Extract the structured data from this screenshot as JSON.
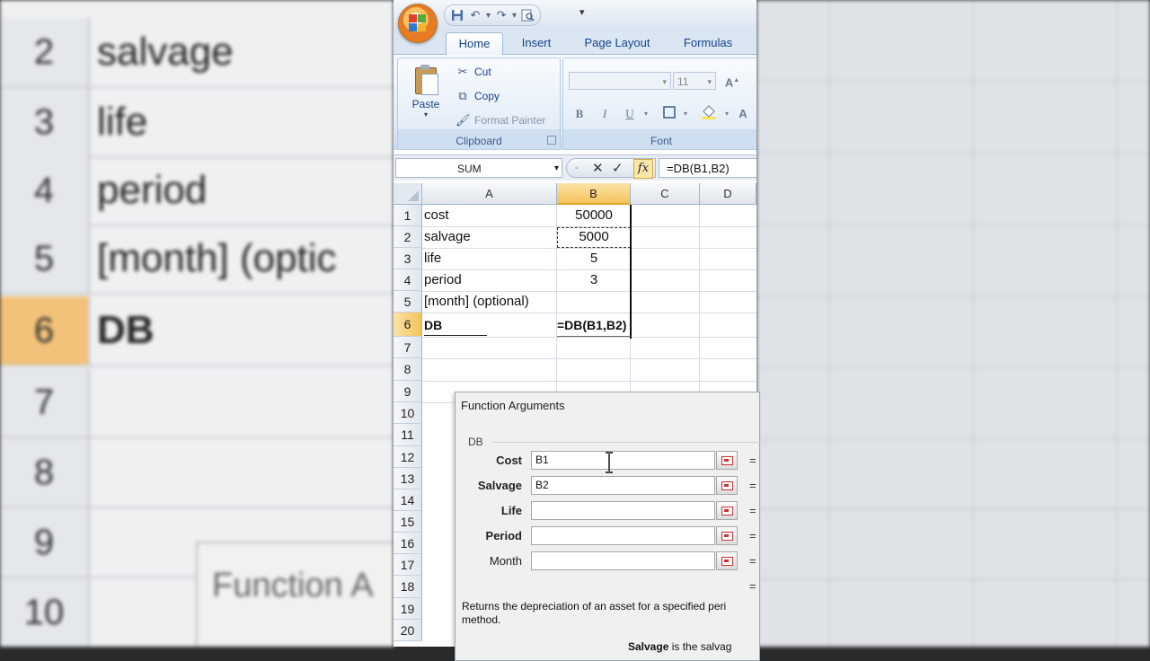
{
  "background": {
    "rows": [
      {
        "num": "2",
        "text": "salvage"
      },
      {
        "num": "3",
        "text": "life"
      },
      {
        "num": "4",
        "text": "period"
      },
      {
        "num": "5",
        "text": "[month] (optic"
      },
      {
        "num": "6",
        "text": "DB"
      },
      {
        "num": "7",
        "text": ""
      },
      {
        "num": "8",
        "text": ""
      },
      {
        "num": "9",
        "text": ""
      },
      {
        "num": "10",
        "text": ""
      }
    ],
    "dialog_text": "Function A"
  },
  "ribbon": {
    "tabs": [
      "Home",
      "Insert",
      "Page Layout",
      "Formulas"
    ],
    "clipboard": {
      "paste": "Paste",
      "cut": "Cut",
      "copy": "Copy",
      "format_painter": "Format Painter",
      "label": "Clipboard"
    },
    "font": {
      "name": "",
      "size": "11",
      "label": "Font"
    }
  },
  "formula_bar": {
    "name_box": "SUM",
    "formula": "=DB(B1,B2)"
  },
  "sheet": {
    "columns": [
      "A",
      "B",
      "C",
      "D"
    ],
    "rows": [
      "1",
      "2",
      "3",
      "4",
      "5",
      "6",
      "7",
      "8",
      "9",
      "10",
      "11",
      "12",
      "13",
      "14",
      "15",
      "16",
      "17",
      "18",
      "19",
      "20"
    ],
    "cells": {
      "a1": "cost",
      "b1": "50000",
      "a2": "salvage",
      "b2": "5000",
      "a3": "life",
      "b3": "5",
      "a4": "period",
      "b4": "3",
      "a5": "[month] (optional)",
      "a6": "DB",
      "b6": "=DB(B1,B2)"
    }
  },
  "dialog": {
    "title": "Function Arguments",
    "function": "DB",
    "args": [
      {
        "label": "Cost",
        "value": "B1",
        "bold": true
      },
      {
        "label": "Salvage",
        "value": "B2",
        "bold": true
      },
      {
        "label": "Life",
        "value": "",
        "bold": true
      },
      {
        "label": "Period",
        "value": "",
        "bold": true
      },
      {
        "label": "Month",
        "value": "",
        "bold": false
      }
    ],
    "equals": "=",
    "description": "Returns the depreciation of an asset for a specified peri method.",
    "bottom_label": "Salvage",
    "bottom_text": "is the salvag"
  },
  "colors": {
    "selected_header": "#f4c35a",
    "ribbon_text": "#15428b"
  }
}
